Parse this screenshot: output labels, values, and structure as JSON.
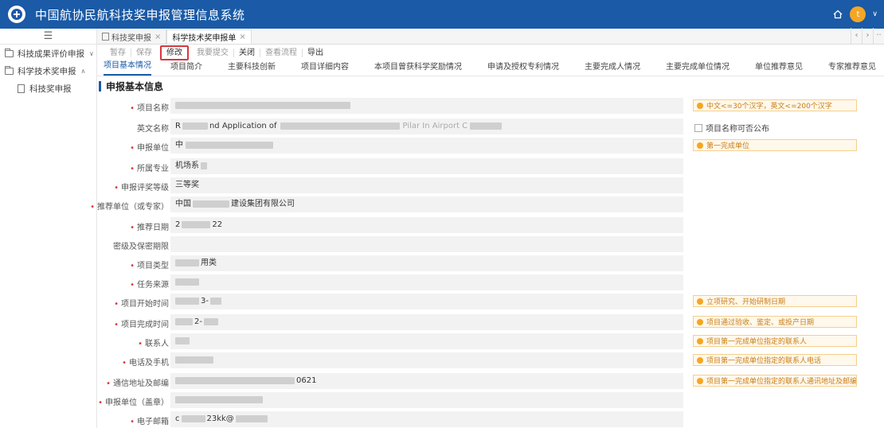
{
  "header": {
    "title": "中国航协民航科技奖申报管理信息系统",
    "avatar_letter": "t"
  },
  "sidebar": {
    "items": [
      {
        "label": "科技成果评价申报",
        "arrow": "∨"
      },
      {
        "label": "科学技术奖申报",
        "arrow": "∧"
      }
    ],
    "sub_items": [
      {
        "label": "科技奖申报"
      }
    ]
  },
  "tabs": [
    {
      "label": "科技奖申报",
      "close": "×"
    },
    {
      "label": "科学技术奖申报单",
      "close": "×"
    }
  ],
  "toolbar": {
    "save_draft": "暂存",
    "save": "保存",
    "modify": "修改",
    "submit": "我要提交",
    "close": "关闭",
    "view_flow": "查看流程",
    "export": "导出"
  },
  "section_tabs": [
    "项目基本情况",
    "项目简介",
    "主要科技创新",
    "项目详细内容",
    "本项目曾获科学奖励情况",
    "申请及授权专利情况",
    "主要完成人情况",
    "主要完成单位情况",
    "单位推荐意见",
    "专家推荐意见",
    "附件"
  ],
  "section_title": "申报基本信息",
  "form": {
    "project_name": {
      "label": "项目名称",
      "tip": "中文<=30个汉字，英文<=200个汉字"
    },
    "english_name": {
      "label": "英文名称",
      "value_a": "R",
      "value_b": "nd Application of",
      "value_c": "Pilar In Airport C",
      "checkbox": "项目名称可否公布"
    },
    "applicant_unit": {
      "label": "申报单位",
      "value": "中",
      "tip": "第一完成单位"
    },
    "major": {
      "label": "所属专业",
      "value": "机场系"
    },
    "award_level": {
      "label": "申报评奖等级",
      "value": "三等奖"
    },
    "recommender": {
      "label": "推荐单位（或专家）",
      "value_a": "中国",
      "value_b": "建设集团有限公司"
    },
    "recommend_date": {
      "label": "推荐日期",
      "value_a": "2",
      "value_b": "22"
    },
    "secret_level": {
      "label": "密级及保密期限"
    },
    "project_type": {
      "label": "项目类型",
      "value": "用类"
    },
    "task_source": {
      "label": "任务来源"
    },
    "start_time": {
      "label": "项目开始时间",
      "value": "3-",
      "tip": "立项研究、开始研制日期"
    },
    "end_time": {
      "label": "项目完成时间",
      "value": "2-",
      "tip": "项目通过验收、鉴定、或投产日期"
    },
    "contact": {
      "label": "联系人",
      "tip": "项目第一完成单位指定的联系人"
    },
    "phone": {
      "label": "电话及手机",
      "tip": "项目第一完成单位指定的联系人电话"
    },
    "address": {
      "label": "通信地址及邮编",
      "value": "0621",
      "tip": "项目第一完成单位指定的联系人通讯地址及邮编"
    },
    "seal_unit": {
      "label": "申报单位（盖章）"
    },
    "email": {
      "label": "电子邮箱",
      "value_a": "c",
      "value_b": "23kk@"
    }
  }
}
